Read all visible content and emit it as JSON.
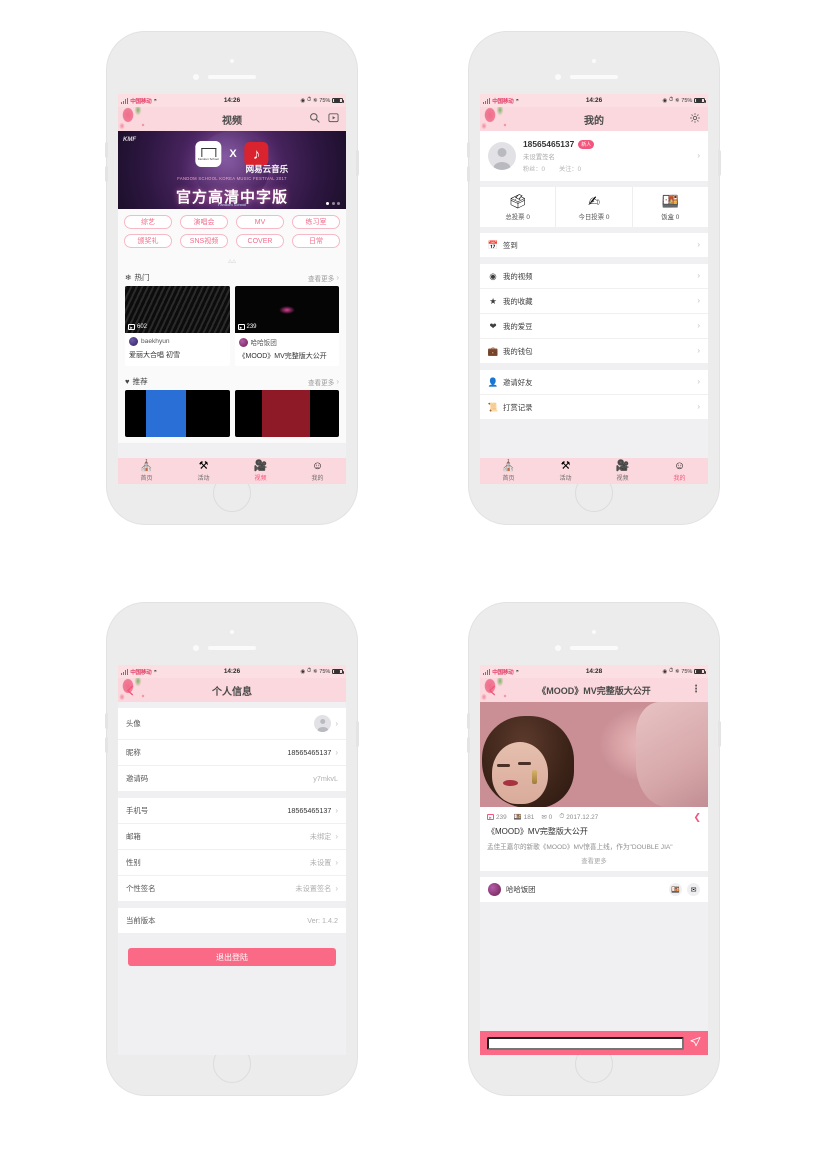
{
  "theme": {
    "pink": "#f2567c",
    "header_pink": "#fbd8dd",
    "status_pink": "#fcdfe2",
    "button_pink": "#fa6a87",
    "bg_gray": "#f0f0f2"
  },
  "status_bar": {
    "carrier": "中国移动",
    "time_1426": "14:26",
    "time_1428": "14:28",
    "battery": "75%",
    "wifi_icon": "wifi-icon",
    "bluetooth_icon": "bluetooth-icon",
    "alarm_icon": "alarm-icon",
    "location_icon": "location-icon"
  },
  "phone1_video": {
    "nav": {
      "title": "视频",
      "search_icon": "search-icon",
      "upload_icon": "upload-video-icon"
    },
    "banner": {
      "brand_left": "Fandom School",
      "x": "X",
      "brand_right": "网易云音乐",
      "festival": "FANDOM SCHOOL KOREA MUSIC FESTIVAL 2017",
      "headline": "官方高清中字版",
      "footer": "Fandom School",
      "kmf": "KMF"
    },
    "tags": [
      "综艺",
      "演唱会",
      "MV",
      "练习室",
      "颁奖礼",
      "SNS视频",
      "COVER",
      "日常"
    ],
    "collapse_icon": "chevron-up-icon",
    "sections": [
      {
        "icon": "hot-icon",
        "title": "热门",
        "more": "查看更多",
        "videos": [
          {
            "views": "602",
            "user": "baekhyun",
            "title": "爱丽大合唱 初雪"
          },
          {
            "views": "239",
            "user": "哈哈饭团",
            "title": "《MOOD》MV完整版大公开"
          }
        ]
      },
      {
        "icon": "recommend-icon",
        "title": "推荐",
        "more": "查看更多",
        "videos": []
      }
    ],
    "tabs": [
      {
        "label": "首页",
        "icon": "home-icon",
        "active": false
      },
      {
        "label": "活动",
        "icon": "activity-icon",
        "active": false
      },
      {
        "label": "视频",
        "icon": "video-icon",
        "active": true
      },
      {
        "label": "我的",
        "icon": "profile-icon",
        "active": false
      }
    ]
  },
  "phone2_mine": {
    "nav": {
      "title": "我的",
      "settings_icon": "gear-icon"
    },
    "profile": {
      "avatar_icon": "avatar-placeholder-icon",
      "name": "18565465137",
      "badge": "新人",
      "signature": "未设置签名",
      "followers_label": "粉丝：0",
      "following_label": "关注：0",
      "chevron": "chevron-right-icon"
    },
    "stats": [
      {
        "icon": "vote-box-icon",
        "label": "总投票 0"
      },
      {
        "icon": "vote-hand-icon",
        "label": "今日投票 0"
      },
      {
        "icon": "lunchbox-icon",
        "label": "饭盒 0"
      }
    ],
    "menu_group1": [
      {
        "icon": "calendar-check-icon",
        "label": "签到"
      }
    ],
    "menu_group2": [
      {
        "icon": "film-reel-icon",
        "label": "我的视频"
      },
      {
        "icon": "star-icon",
        "label": "我的收藏"
      },
      {
        "icon": "heart-icon",
        "label": "我的爱豆"
      },
      {
        "icon": "wallet-icon",
        "label": "我的钱包"
      }
    ],
    "menu_group3": [
      {
        "icon": "user-plus-icon",
        "label": "邀请好友"
      },
      {
        "icon": "reward-record-icon",
        "label": "打赏记录"
      }
    ],
    "tabs": [
      {
        "label": "首页",
        "icon": "home-icon",
        "active": false
      },
      {
        "label": "活动",
        "icon": "activity-icon",
        "active": false
      },
      {
        "label": "视频",
        "icon": "video-icon",
        "active": false
      },
      {
        "label": "我的",
        "icon": "profile-icon",
        "active": true
      }
    ]
  },
  "phone3_info": {
    "nav": {
      "title": "个人信息",
      "back_icon": "chevron-left-icon"
    },
    "rows_group1": [
      {
        "key": "头像",
        "value": "",
        "type": "avatar",
        "chevron": true
      },
      {
        "key": "昵称",
        "value": "18565465137",
        "chevron": true
      },
      {
        "key": "邀请码",
        "value": "y7mkvL",
        "muted": true,
        "chevron": false
      }
    ],
    "rows_group2": [
      {
        "key": "手机号",
        "value": "18565465137",
        "chevron": true
      },
      {
        "key": "邮箱",
        "value": "未绑定",
        "muted": true,
        "chevron": true
      },
      {
        "key": "性别",
        "value": "未设置",
        "muted": true,
        "chevron": true
      },
      {
        "key": "个性签名",
        "value": "未设置签名",
        "muted": true,
        "chevron": true
      }
    ],
    "rows_group3": [
      {
        "key": "当前版本",
        "value": "Ver: 1.4.2",
        "muted": true,
        "chevron": false
      }
    ],
    "logout_label": "退出登陆"
  },
  "phone4_detail": {
    "nav": {
      "title": "《MOOD》MV完整版大公开",
      "back_icon": "chevron-left-icon",
      "menu_icon": "more-dots-icon"
    },
    "stats": {
      "views": "239",
      "likes": "181",
      "comments": "0",
      "date": "2017.12.27",
      "views_icon": "play-count-icon",
      "likes_icon": "lunchbox-icon",
      "comments_icon": "vote-icon",
      "date_icon": "clock-icon",
      "share_icon": "share-icon"
    },
    "title": "《MOOD》MV完整版大公开",
    "description": "孟佳王嘉尔的新歌《MOOD》MV惊喜上线，作为\"DOUBLE JIA\"",
    "more_label": "查看更多",
    "uploader": {
      "name": "哈哈饭团",
      "avatar_icon": "avatar-icon",
      "action1_icon": "lunchbox-icon",
      "action2_icon": "vote-icon"
    },
    "comment": {
      "placeholder": "",
      "send_icon": "send-icon"
    }
  }
}
